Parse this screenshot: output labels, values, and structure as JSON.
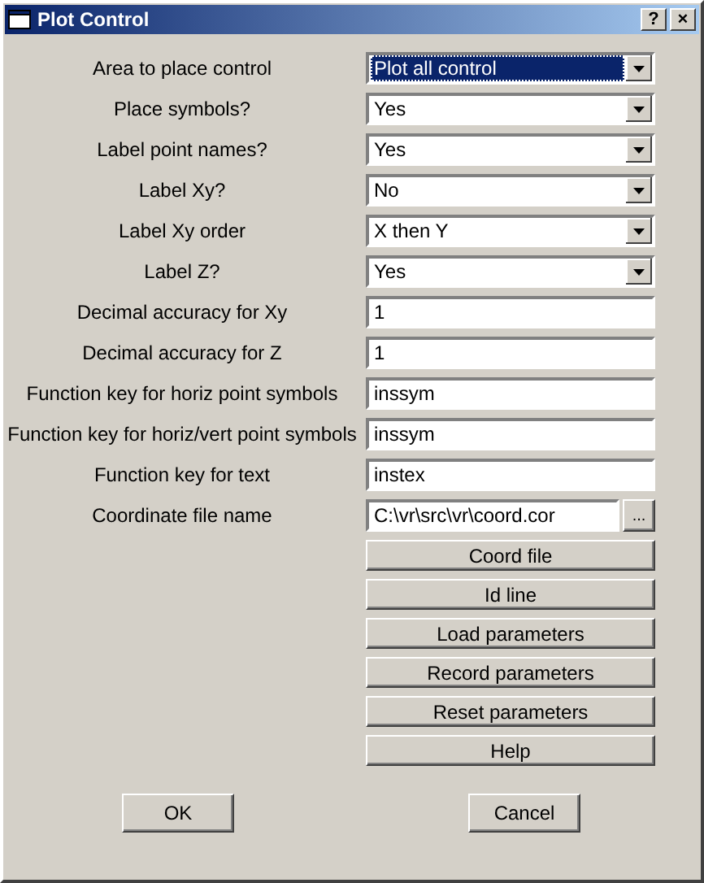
{
  "window": {
    "title": "Plot Control",
    "title_buttons": [
      "?",
      "×"
    ]
  },
  "fields": [
    {
      "kind": "dropdown",
      "label": "Area to place control",
      "value": "Plot all control",
      "focused": true
    },
    {
      "kind": "dropdown",
      "label": "Place symbols?",
      "value": "Yes",
      "focused": false
    },
    {
      "kind": "dropdown",
      "label": "Label point names?",
      "value": "Yes",
      "focused": false
    },
    {
      "kind": "dropdown",
      "label": "Label Xy?",
      "value": "No",
      "focused": false
    },
    {
      "kind": "dropdown",
      "label": "Label Xy order",
      "value": "X then Y",
      "focused": false
    },
    {
      "kind": "dropdown",
      "label": "Label Z?",
      "value": "Yes",
      "focused": false
    },
    {
      "kind": "text",
      "label": "Decimal accuracy for Xy",
      "value": "1"
    },
    {
      "kind": "text",
      "label": "Decimal accuracy for Z",
      "value": "1"
    },
    {
      "kind": "text",
      "label": "Function key for horiz point symbols",
      "value": "inssym"
    },
    {
      "kind": "text",
      "label": "Function key for horiz/vert point symbols",
      "value": "inssym"
    },
    {
      "kind": "text",
      "label": "Function key for text",
      "value": "instex"
    },
    {
      "kind": "file",
      "label": "Coordinate file name",
      "value": "C:\\vr\\src\\vr\\coord.cor",
      "browse": "..."
    }
  ],
  "actions": [
    "Coord file",
    "Id line",
    "Load parameters",
    "Record parameters",
    "Reset parameters",
    "Help"
  ],
  "buttons": [
    "OK",
    "Cancel"
  ]
}
